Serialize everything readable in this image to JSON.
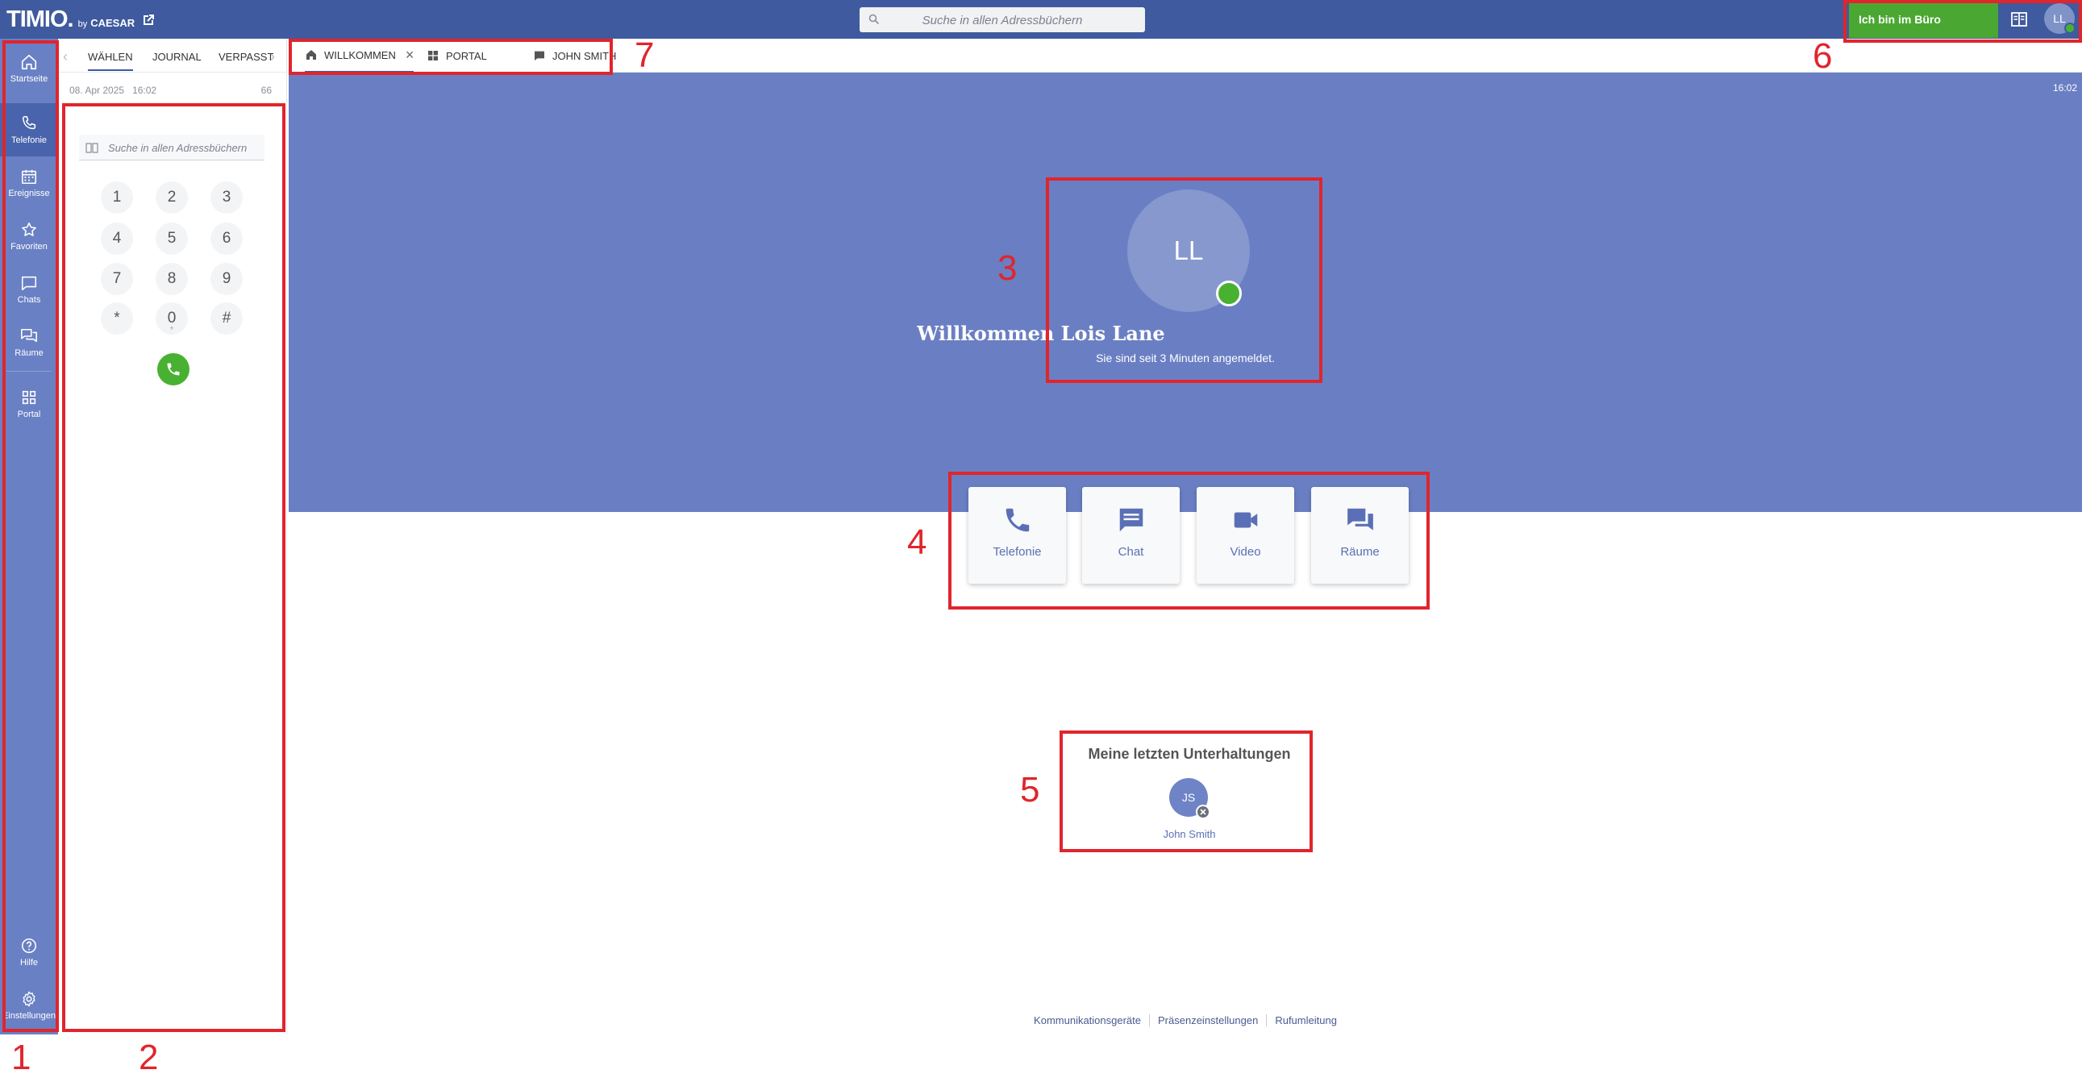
{
  "app": {
    "logo": "TIMIO.",
    "logo_by": "by",
    "logo_brand": "CAESAR",
    "search_placeholder": "Suche in allen Adressbüchern",
    "presence_label": "Ich bin im Büro",
    "user_initials": "LL"
  },
  "rail": {
    "items": [
      {
        "label": "Startseite",
        "icon": "home-icon"
      },
      {
        "label": "Telefonie",
        "icon": "phone-icon"
      },
      {
        "label": "Ereignisse",
        "icon": "calendar-icon"
      },
      {
        "label": "Favoriten",
        "icon": "star-icon"
      },
      {
        "label": "Chats",
        "icon": "chat-icon"
      },
      {
        "label": "Räume",
        "icon": "rooms-icon"
      },
      {
        "label": "Portal",
        "icon": "grid-icon"
      }
    ],
    "bottom": [
      {
        "label": "Hilfe",
        "icon": "help-icon"
      },
      {
        "label": "Einstellungen",
        "icon": "gear-icon"
      }
    ]
  },
  "dial": {
    "tabs": [
      "WÄHLEN",
      "JOURNAL",
      "VERPASST"
    ],
    "date": "08. Apr 2025",
    "time": "16:02",
    "count": "66",
    "search_placeholder": "Suche in allen Adressbüchern",
    "keys": [
      "1",
      "2",
      "3",
      "4",
      "5",
      "6",
      "7",
      "8",
      "9",
      "*",
      "0",
      "#"
    ],
    "zero_sub": "+"
  },
  "workspace_tabs": [
    {
      "label": "WILLKOMMEN",
      "icon": "home-icon"
    },
    {
      "label": "PORTAL",
      "icon": "grid-icon"
    },
    {
      "label": "JOHN SMITH",
      "icon": "chat-icon"
    }
  ],
  "welcome": {
    "time": "16:02",
    "initials": "LL",
    "title": "Willkommen Lois Lane",
    "subtitle": "Sie sind seit 3 Minuten angemeldet."
  },
  "actions": [
    {
      "label": "Telefonie",
      "icon": "phone-icon"
    },
    {
      "label": "Chat",
      "icon": "chat-icon"
    },
    {
      "label": "Video",
      "icon": "video-icon"
    },
    {
      "label": "Räume",
      "icon": "rooms-icon"
    }
  ],
  "recent": {
    "title": "Meine letzten Unterhaltungen",
    "initials": "JS",
    "name": "John Smith"
  },
  "footer": {
    "links": [
      "Kommunikationsgeräte",
      "Präsenzeinstellungen",
      "Rufumleitung"
    ]
  },
  "annotations": [
    "1",
    "2",
    "3",
    "4",
    "5",
    "6",
    "7"
  ],
  "colors": {
    "header": "#3f5a9e",
    "rail": "#6980c4",
    "banner": "#6a7fc3",
    "presence_green": "#4aa832",
    "annotation_red": "#e0252c"
  }
}
